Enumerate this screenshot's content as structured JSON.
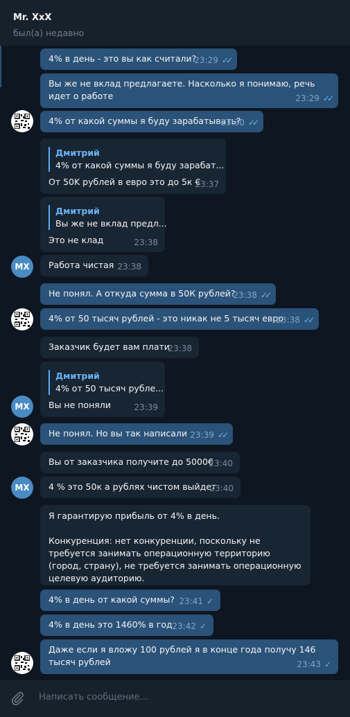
{
  "header": {
    "title": "Mr. XxX",
    "status": "был(а) недавно"
  },
  "avatars": {
    "mx_initials": "MX"
  },
  "messages": [
    {
      "text": "4% в день - это вы как считали?",
      "time": "23:29"
    },
    {
      "text": "Вы же не вклад предлагаете. Насколько я понимаю, речь идет о работе",
      "time": "23:29"
    },
    {
      "text": "4% от какой суммы я буду зарабатывать?",
      "time": "23:30"
    },
    {
      "reply_name": "Дмитрий",
      "reply_text": "4% от какой суммы я буду зарабат...",
      "text": "От 50K рублей в евро это до 5к €",
      "time": "23:37"
    },
    {
      "reply_name": "Дмитрий",
      "reply_text": "Вы же не вклад предл...",
      "text": "Это не клад",
      "time": "23:38"
    },
    {
      "text": "Работа чистая",
      "time": "23:38"
    },
    {
      "text": "Не понял. А откуда сумма в 50К рублей?",
      "time": "23:38"
    },
    {
      "text": "4% от 50 тысяч рублей - это никак не 5 тысяч евро",
      "time": "23:38"
    },
    {
      "text": "Заказчик будет вам плати",
      "time": "23:38"
    },
    {
      "reply_name": "Дмитрий",
      "reply_text": "4% от 50 тысяч рубле...",
      "text": "Вы не поняли",
      "time": "23:39"
    },
    {
      "text": "Не понял. Но вы так написали",
      "time": "23:39"
    },
    {
      "text": "Вы от заказчика получите до 5000€",
      "time": "23:40"
    },
    {
      "text": "4 % это 50к а рублях чистом выйдет",
      "time": "23:40"
    },
    {
      "text": "Я гарантирую прибыль от 4% в день.\n\nКонкуренция: нет конкуренции, поскольку не требуется занимать операционную территорию (город, страну), не требуется занимать операционную целевую аудиторию.",
      "time": ""
    },
    {
      "text": "4% в день от какой суммы?",
      "time": "23:41"
    },
    {
      "text": "4% в день это 1460% в год",
      "time": "23:42"
    },
    {
      "text": "Даже если я вложу 100 рублей я в конце года получу 146 тысяч рублей",
      "time": "23:43"
    }
  ],
  "composer": {
    "placeholder": "Написать сообщение..."
  },
  "colors": {
    "background": "#0e1621",
    "outgoing": "#2b5278",
    "incoming": "#182533",
    "accent": "#64b5f6"
  }
}
